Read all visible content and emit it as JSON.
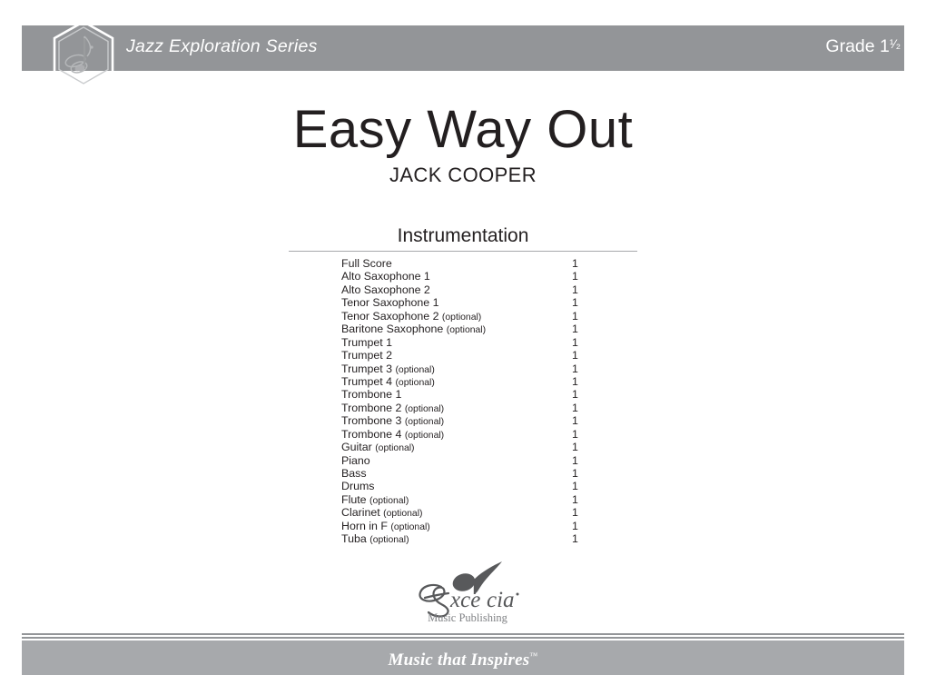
{
  "page": {
    "background_color": "#ffffff",
    "band_color": "#939598",
    "footer_band_color": "#a7a9ac",
    "text_color": "#231f20"
  },
  "header": {
    "series_title": "Jazz Exploration Series",
    "grade_prefix": "Grade 1",
    "grade_fraction": "¹⁄₂",
    "grade_full": "Grade 1¹⁄₂",
    "logo_icon": "hexagon-music-note-logo-icon"
  },
  "title_block": {
    "title": "Easy Way Out",
    "composer": "JACK COOPER"
  },
  "instrumentation": {
    "heading": "Instrumentation",
    "items": [
      {
        "name": "Full Score",
        "optional": "",
        "qty": "1"
      },
      {
        "name": "Alto Saxophone 1",
        "optional": "",
        "qty": "1"
      },
      {
        "name": "Alto Saxophone 2",
        "optional": "",
        "qty": "1"
      },
      {
        "name": "Tenor Saxophone 1",
        "optional": "",
        "qty": "1"
      },
      {
        "name": "Tenor Saxophone 2",
        "optional": "(optional)",
        "qty": "1"
      },
      {
        "name": "Baritone Saxophone",
        "optional": "(optional)",
        "qty": "1"
      },
      {
        "name": "Trumpet 1",
        "optional": "",
        "qty": "1"
      },
      {
        "name": "Trumpet 2",
        "optional": "",
        "qty": "1"
      },
      {
        "name": "Trumpet 3",
        "optional": "(optional)",
        "qty": "1"
      },
      {
        "name": "Trumpet 4",
        "optional": "(optional)",
        "qty": "1"
      },
      {
        "name": "Trombone 1",
        "optional": "",
        "qty": "1"
      },
      {
        "name": "Trombone 2",
        "optional": "(optional)",
        "qty": "1"
      },
      {
        "name": "Trombone 3",
        "optional": "(optional)",
        "qty": "1"
      },
      {
        "name": "Trombone 4",
        "optional": "(optional)",
        "qty": "1"
      },
      {
        "name": "Guitar",
        "optional": "(optional)",
        "qty": "1"
      },
      {
        "name": "Piano",
        "optional": "",
        "qty": "1"
      },
      {
        "name": "Bass",
        "optional": "",
        "qty": "1"
      },
      {
        "name": "Drums",
        "optional": "",
        "qty": "1"
      },
      {
        "name": "Flute",
        "optional": "(optional)",
        "qty": "1"
      },
      {
        "name": "Clarinet",
        "optional": "(optional)",
        "qty": "1"
      },
      {
        "name": "Horn in F",
        "optional": "(optional)",
        "qty": "1"
      },
      {
        "name": "Tuba",
        "optional": "(optional)",
        "qty": "1"
      }
    ]
  },
  "publisher": {
    "logo_icon": "excelcia-script-note-logo-icon",
    "name": "Excelcia",
    "subtitle": "Music Publishing"
  },
  "footer": {
    "tagline": "Music that Inspires",
    "trademark": "™"
  }
}
